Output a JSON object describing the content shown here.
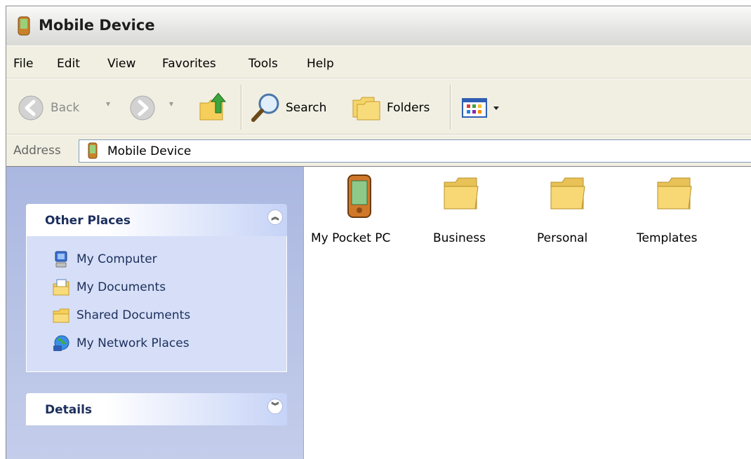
{
  "window": {
    "title": "Mobile Device"
  },
  "menu": {
    "items": [
      "File",
      "Edit",
      "View",
      "Favorites",
      "Tools",
      "Help"
    ]
  },
  "toolbar": {
    "back_label": "Back",
    "search_label": "Search",
    "folders_label": "Folders"
  },
  "address": {
    "label": "Address",
    "value": "Mobile Device"
  },
  "taskpane": {
    "other_places": {
      "title": "Other Places",
      "items": [
        {
          "label": "My Computer",
          "icon": "my-computer-icon"
        },
        {
          "label": "My Documents",
          "icon": "my-documents-icon"
        },
        {
          "label": "Shared Documents",
          "icon": "shared-documents-icon"
        },
        {
          "label": "My Network Places",
          "icon": "network-places-icon"
        }
      ]
    },
    "details": {
      "title": "Details"
    }
  },
  "files": [
    {
      "label": "My Pocket PC",
      "icon": "pocket-pc-icon"
    },
    {
      "label": "Business",
      "icon": "folder-icon"
    },
    {
      "label": "Personal",
      "icon": "folder-icon"
    },
    {
      "label": "Templates",
      "icon": "folder-icon"
    }
  ],
  "colors": {
    "title_bar": "#e6e6e4",
    "task_pane": "#aab7e0",
    "folder": "#f8d775"
  }
}
